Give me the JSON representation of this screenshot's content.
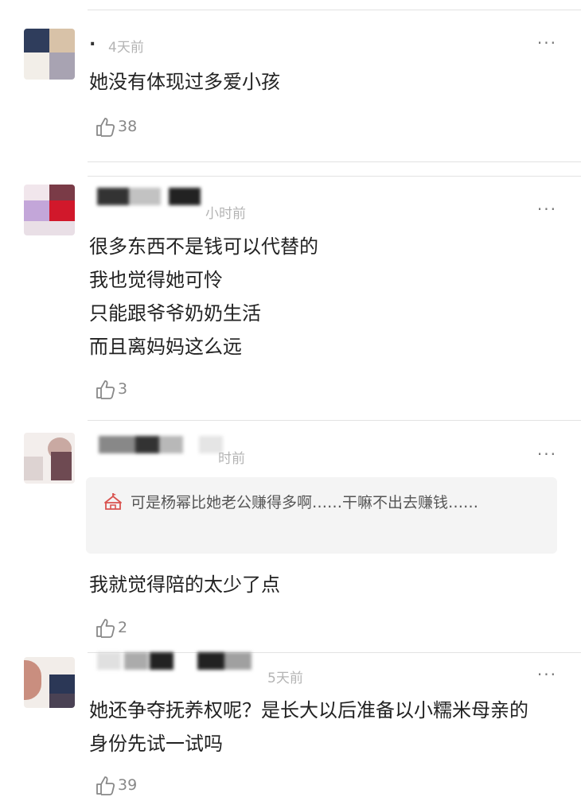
{
  "comments": [
    {
      "username": ".",
      "time": "4天前",
      "more": "···",
      "text": "她没有体现过多爱小孩",
      "likes": "38"
    },
    {
      "username": "",
      "time": "小时前",
      "more": "···",
      "text": "很多东西不是钱可以代替的\n我也觉得她可怜\n只能跟爷爷奶奶生活\n而且离妈妈这么远",
      "likes": "3"
    },
    {
      "username": "",
      "time": "时前",
      "more": "···",
      "quote": "可是杨幂比她老公赚得多啊……干嘛不出去赚钱……",
      "text": "我就觉得陪的太少了点",
      "likes": "2"
    },
    {
      "username": "",
      "time": "5天前",
      "more": "···",
      "text": "她还争夺抚养权呢？是长大以后准备以小糯米母亲的身份先试一试吗",
      "likes": "39"
    }
  ],
  "colors": {
    "meta": "#b4b4b4",
    "text": "#222222",
    "divider": "#e2e2e2",
    "quote_bg": "#f4f4f4",
    "quote_icon": "#d9534f"
  },
  "icons": {
    "like": "thumbs-up-outline-icon",
    "more": "more-horizontal-icon",
    "quote": "circus-tent-icon"
  }
}
